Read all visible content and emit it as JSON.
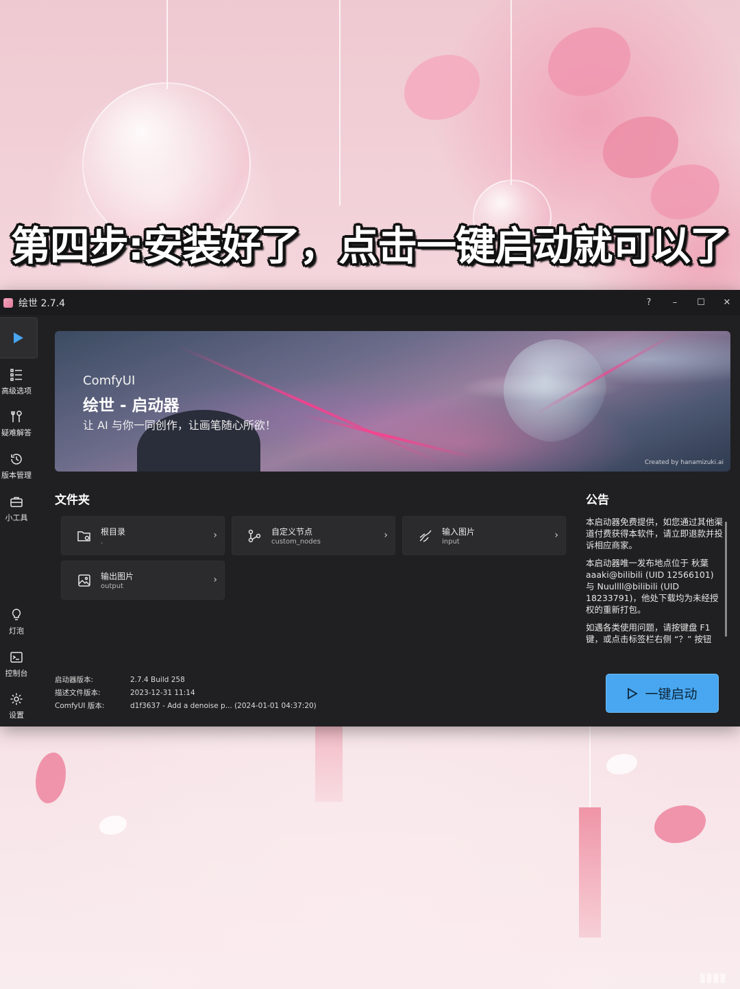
{
  "caption": "第四步:安装好了，点击一键启动就可以了",
  "window": {
    "title": "绘世 2.7.4",
    "controls": {
      "help": "?",
      "minimize": "–",
      "maximize": "☐",
      "close": "✕"
    }
  },
  "sidebar": {
    "items": [
      {
        "label": "高级选项"
      },
      {
        "label": "疑难解答"
      },
      {
        "label": "版本管理"
      },
      {
        "label": "小工具"
      },
      {
        "label": "灯泡"
      },
      {
        "label": "控制台"
      },
      {
        "label": "设置"
      }
    ]
  },
  "banner": {
    "subtitle": "ComfyUI",
    "title": "绘世 - 启动器",
    "slogan": "让 AI 与你一同创作，让画笔随心所欲！",
    "credit": "Created by hanamizuki.ai"
  },
  "folders": {
    "title": "文件夹",
    "cards": [
      {
        "title": "根目录",
        "sub": "."
      },
      {
        "title": "自定义节点",
        "sub": "custom_nodes"
      },
      {
        "title": "输入图片",
        "sub": "input"
      },
      {
        "title": "输出图片",
        "sub": "output"
      }
    ]
  },
  "notice": {
    "title": "公告",
    "paragraphs": [
      "本启动器免费提供，如您通过其他渠道付费获得本软件，请立即退款并投诉相应商家。",
      "本启动器唯一发布地点位于 秋葉aaaki@bilibili (UID 12566101) 与 Nuullll@bilibili (UID 18233791)，他处下载均为未经授权的重新打包。",
      "如遇各类使用问题，请按键盘 F1 键，或点击标签栏右侧 “？” 按钮"
    ]
  },
  "version": {
    "launcher_label": "启动器版本:",
    "launcher_value": "2.7.4 Build 258",
    "desc_label": "描述文件版本:",
    "desc_value": "2023-12-31 11:14",
    "comfy_label": "ComfyUI 版本:",
    "comfy_value": "d1f3637 - Add a denoise p... (2024-01-01 04:37:20)"
  },
  "launch": {
    "label": "一键启动"
  },
  "colors": {
    "accent": "#48a7f0",
    "window_bg": "#202022",
    "card_bg": "#2b2b2e"
  }
}
